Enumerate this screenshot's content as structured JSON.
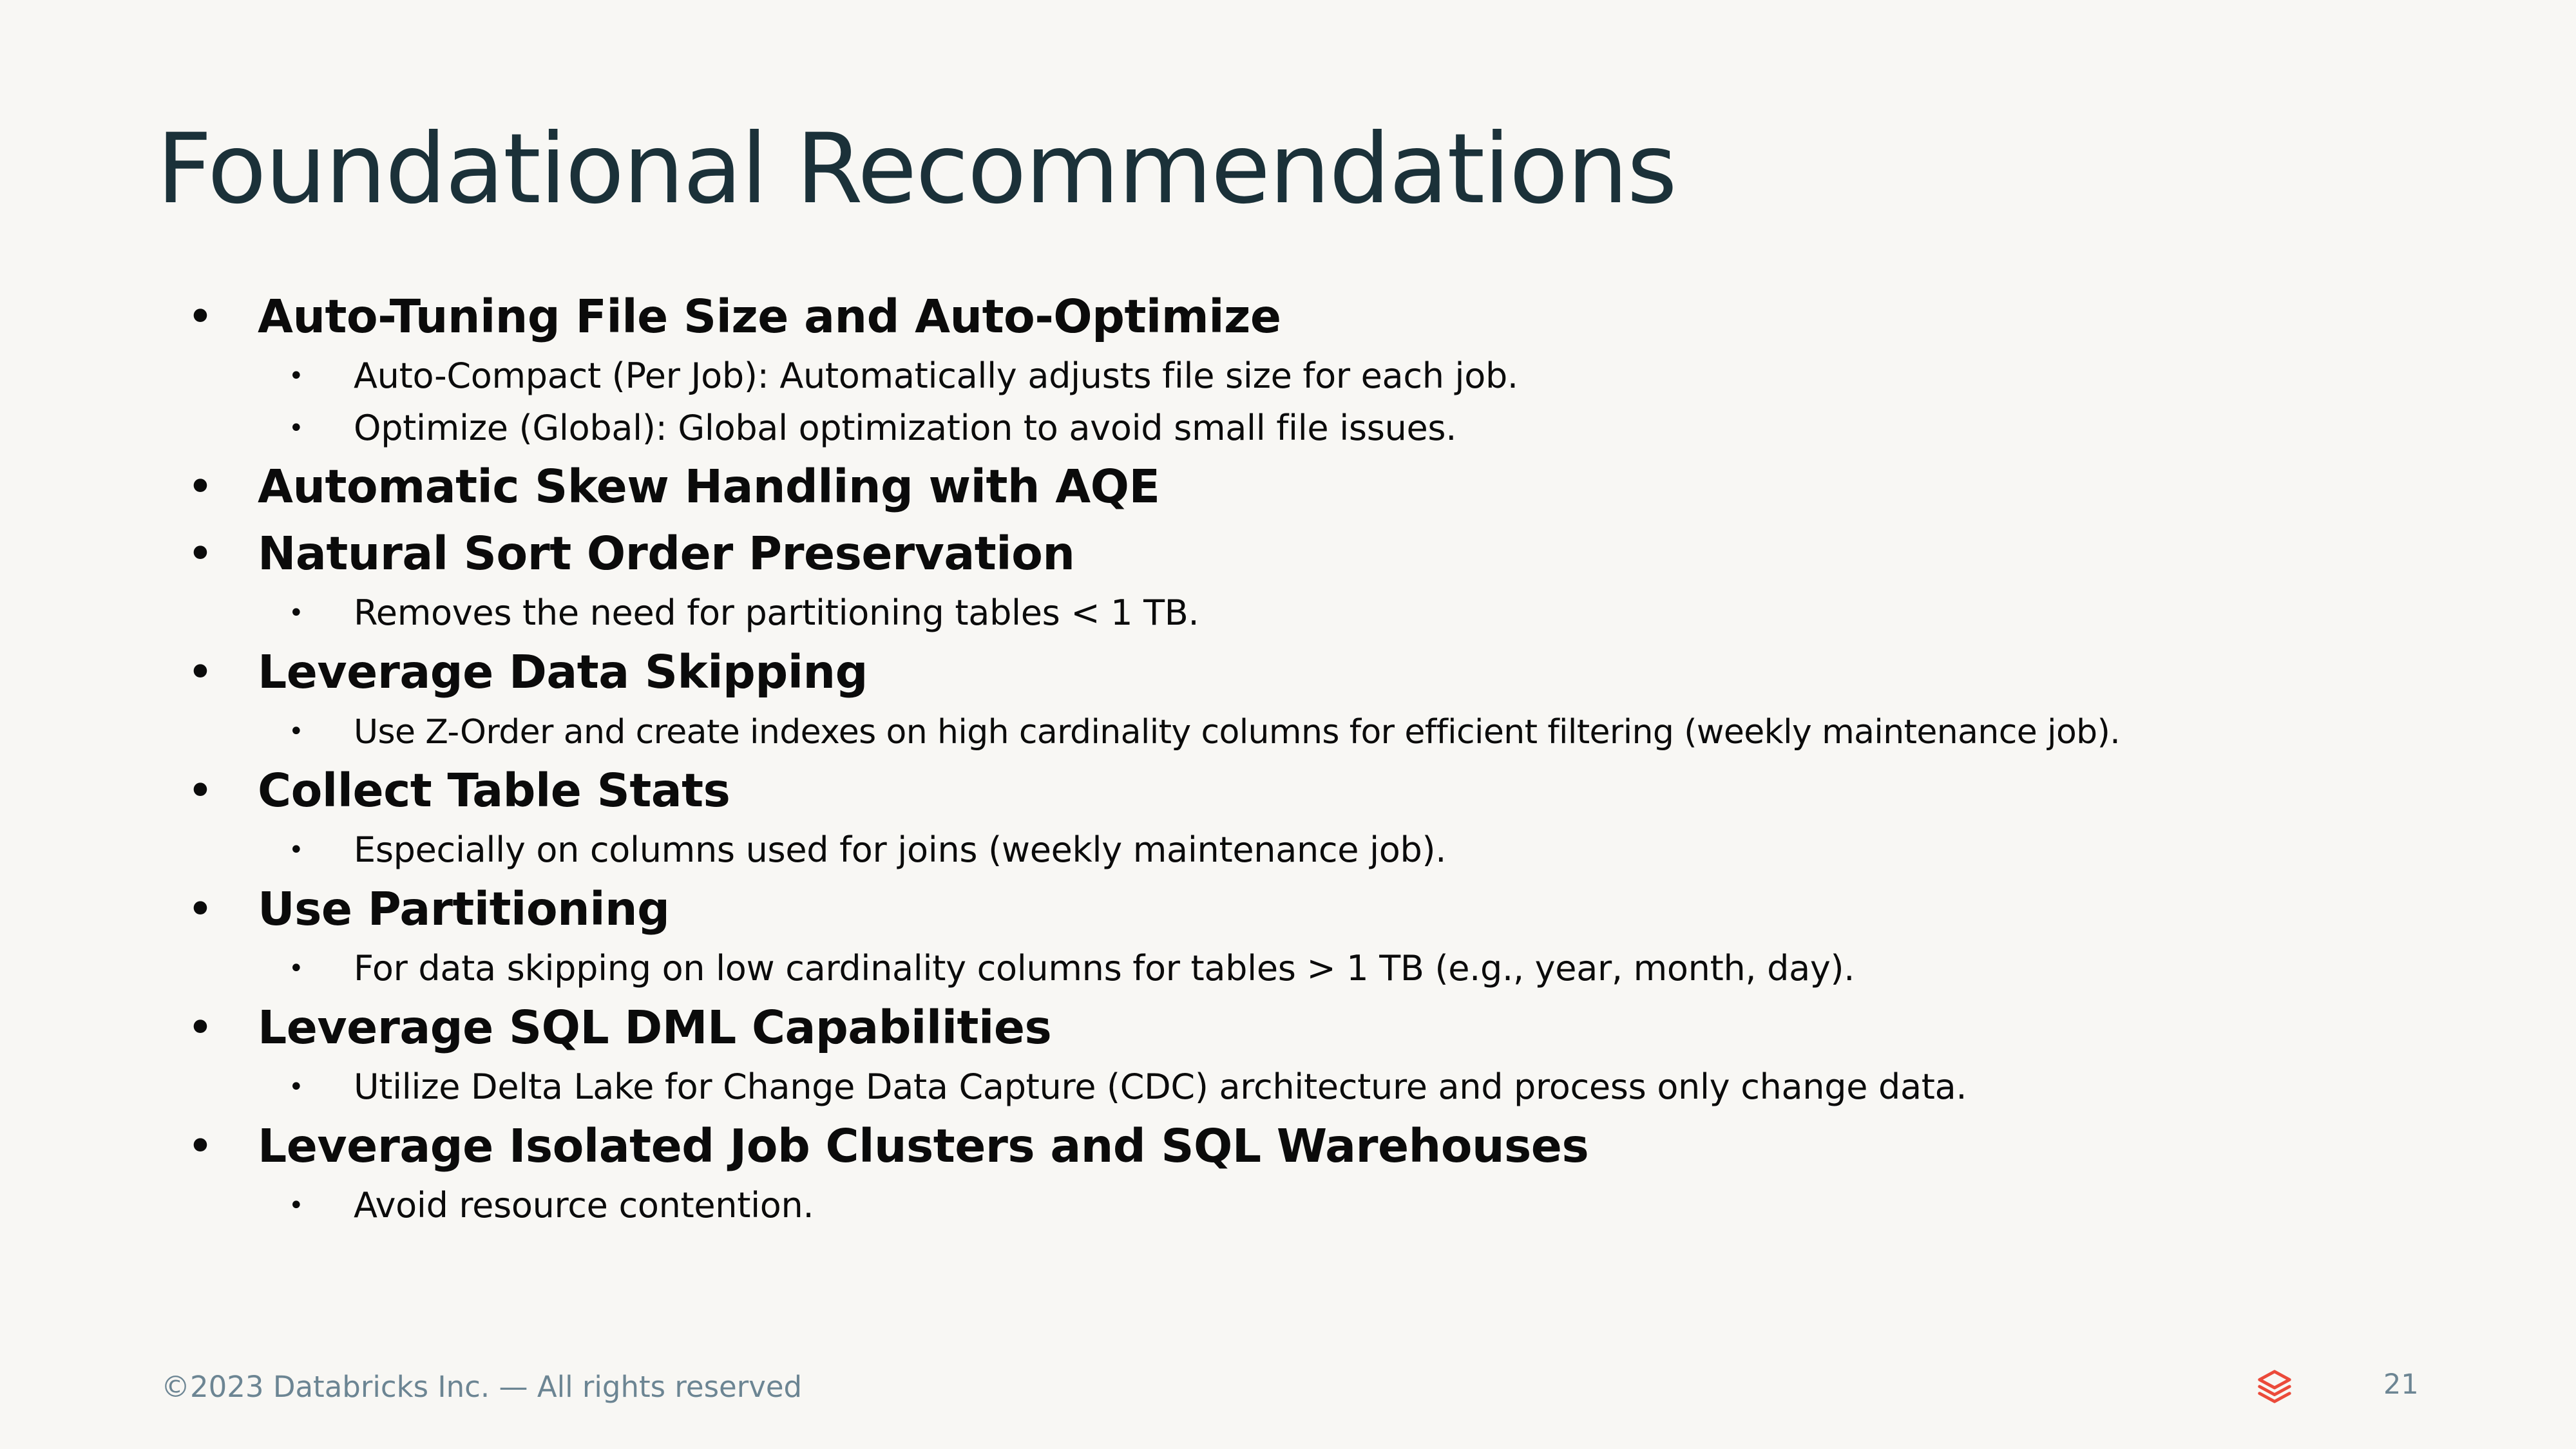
{
  "slide": {
    "title": "Foundational Recommendations",
    "bullet_glyph": "•",
    "items": [
      {
        "text": "Auto-Tuning File Size and Auto-Optimize"
      },
      {
        "text": "Auto-Compact (Per Job): Automatically adjusts file size for each job."
      },
      {
        "text": "Optimize (Global): Global optimization to avoid small file issues."
      },
      {
        "text": "Automatic Skew Handling with AQE"
      },
      {
        "text": "Natural Sort Order Preservation"
      },
      {
        "text": "Removes the need for partitioning tables < 1 TB."
      },
      {
        "text": "Leverage Data Skipping"
      },
      {
        "text": "Use Z-Order and create indexes on high cardinality columns for efficient filtering (weekly maintenance job)."
      },
      {
        "text": "Collect Table Stats"
      },
      {
        "text": "Especially on columns used for joins (weekly maintenance job)."
      },
      {
        "text": "Use Partitioning"
      },
      {
        "text": "For data skipping on low cardinality columns for tables > 1 TB (e.g., year, month, day)."
      },
      {
        "text": "Leverage SQL DML Capabilities"
      },
      {
        "text": "Utilize Delta Lake for Change Data Capture (CDC) architecture and process only change data."
      },
      {
        "text": "Leverage Isolated Job Clusters and SQL Warehouses"
      },
      {
        "text": "Avoid resource contention."
      }
    ]
  },
  "footer": {
    "copyright": "©2023 Databricks Inc. — All rights reserved",
    "logo_icon": "databricks-logo-icon",
    "page_number": "21"
  },
  "colors": {
    "background": "#f8f7f4",
    "title": "#1b3139",
    "body_text": "#0b0b0b",
    "footer_text": "#6c8593",
    "logo": "#eb4a3a"
  }
}
